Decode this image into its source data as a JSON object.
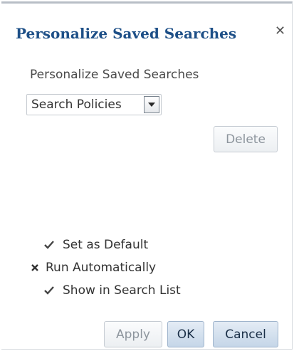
{
  "dialog": {
    "title": "Personalize Saved Searches",
    "close_icon": "close-icon"
  },
  "section": {
    "label": "Personalize Saved Searches"
  },
  "saved_search_select": {
    "value": "Search Policies",
    "icon": "dropdown-arrow-icon"
  },
  "buttons": {
    "delete": "Delete",
    "apply": "Apply",
    "ok": "OK",
    "cancel": "Cancel"
  },
  "options": {
    "set_as_default": {
      "label": "Set as Default",
      "checked": true,
      "icon": "checkmark-icon"
    },
    "run_automatically": {
      "label": "Run Automatically",
      "checked": false,
      "icon": "x-mark-icon"
    },
    "show_in_search_list": {
      "label": "Show in Search List",
      "checked": true,
      "icon": "checkmark-icon"
    }
  },
  "colors": {
    "title": "#1d4f87",
    "text": "#333333",
    "disabled_text": "#8d959d",
    "primary_button_bg": "#c5d6e8"
  }
}
